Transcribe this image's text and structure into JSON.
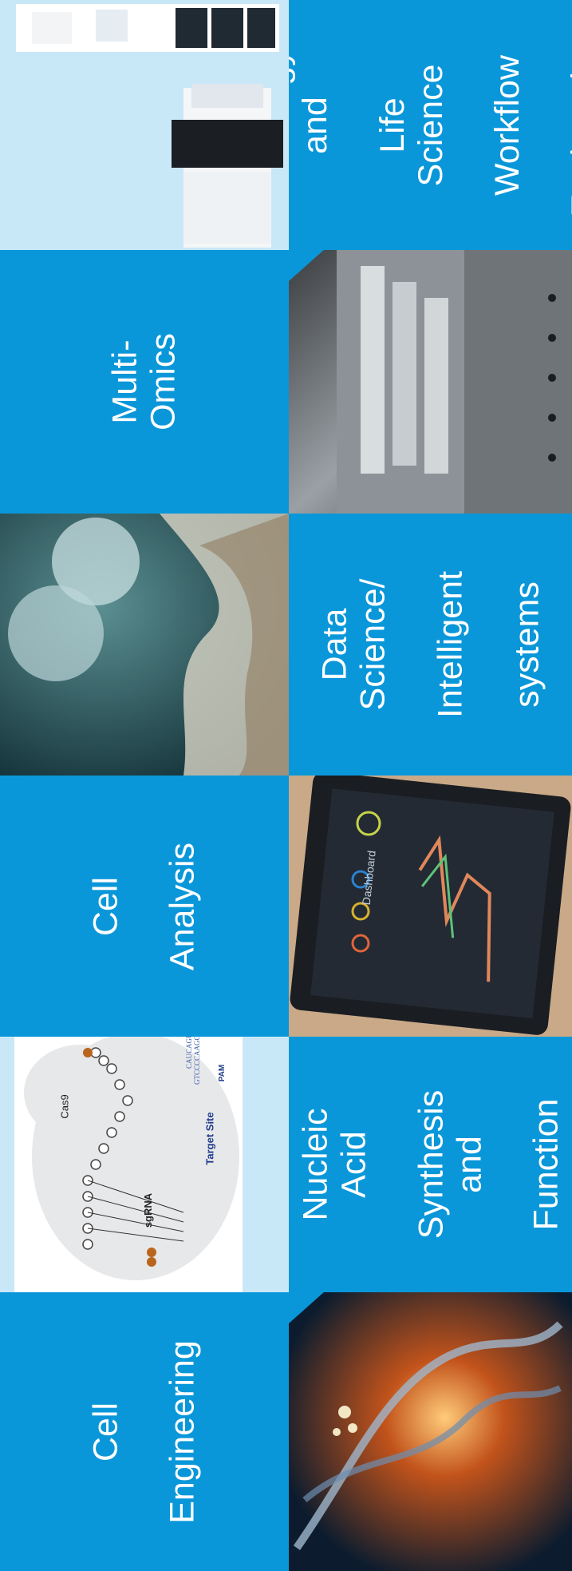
{
  "colors": {
    "tile_blue": "#0a97d9",
    "light_blue": "#bfe4f6"
  },
  "tiles": {
    "pathology": {
      "lines": [
        "Pathology and",
        "Life Science",
        "Workflow",
        "Engineering"
      ]
    },
    "multi_omics": {
      "lines": [
        "Multi-Omics"
      ]
    },
    "data_science": {
      "lines": [
        "Data Science/",
        "Intelligent",
        "systems"
      ]
    },
    "cell_analysis": {
      "lines": [
        "Cell",
        "Analysis"
      ]
    },
    "nucleic_acid": {
      "lines": [
        "Nucleic Acid",
        "Synthesis and",
        "Function"
      ]
    },
    "cell_engineering": {
      "lines": [
        "Cell",
        "Engineering"
      ]
    }
  },
  "diagram": {
    "cas9_label": "Cas9",
    "sgrna_label": "sgRNA",
    "target_site_label": "Target Site",
    "pam_label": "PAM"
  },
  "tablet": {
    "header": "Dashboard"
  }
}
